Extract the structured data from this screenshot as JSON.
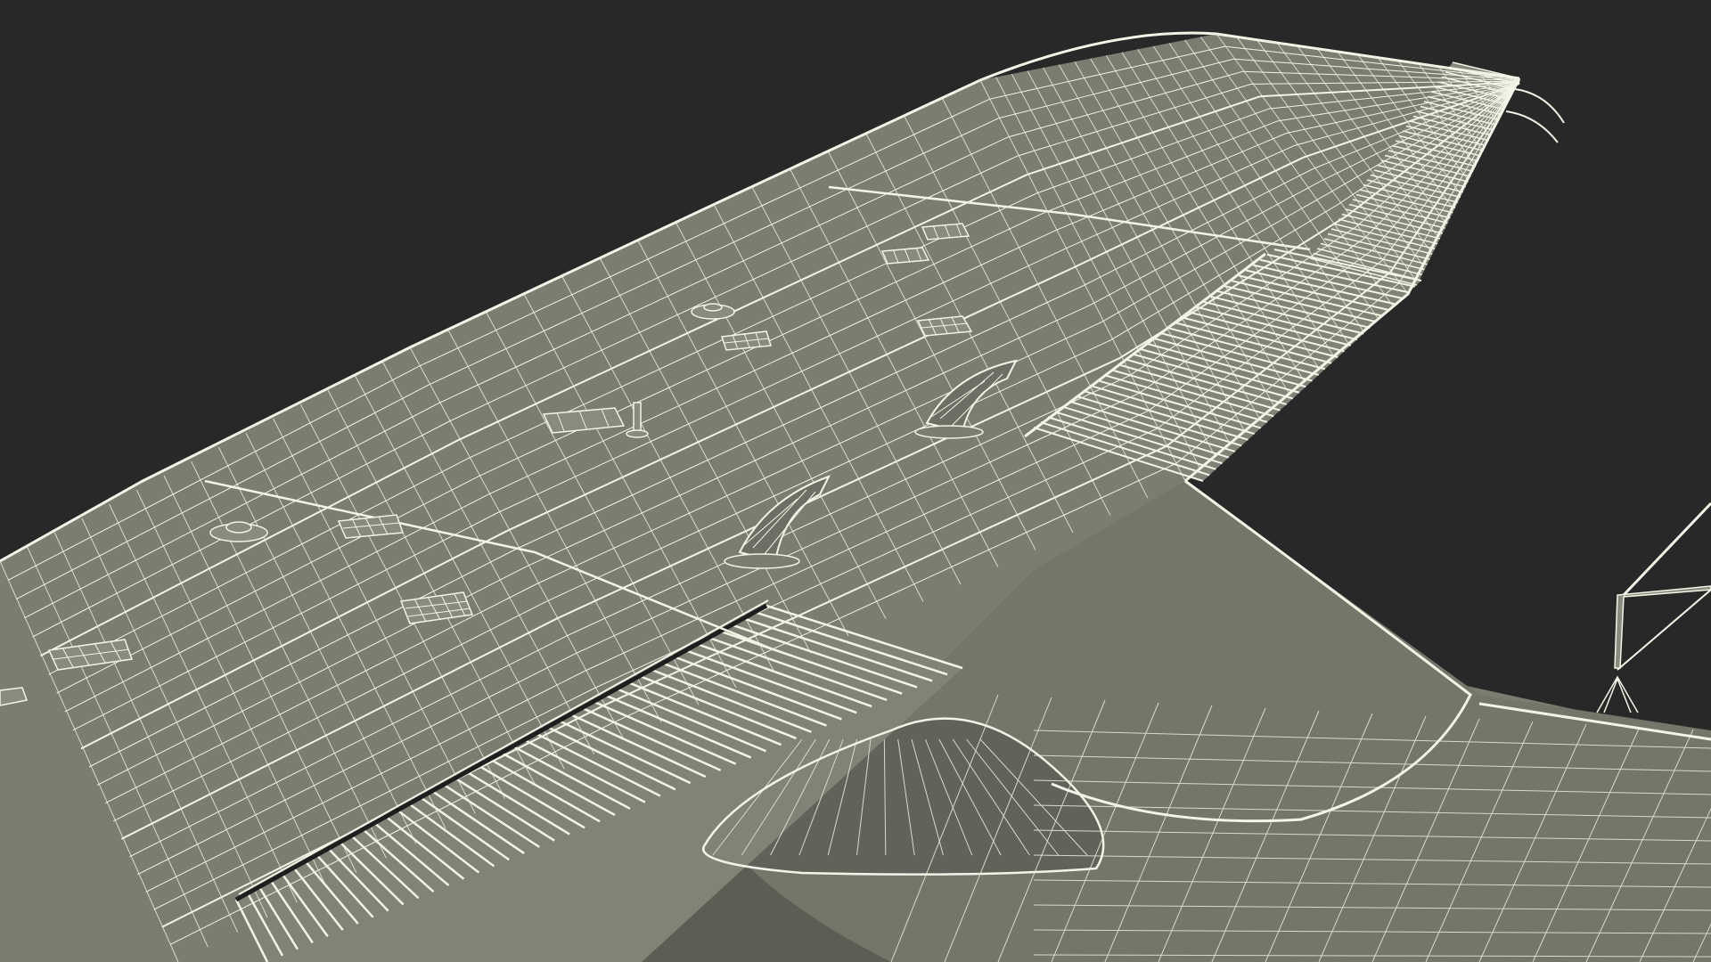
{
  "scene": {
    "subject": "wing-wireframe",
    "colors": {
      "background": "#282828",
      "surface": "#7c7c70",
      "surface_shadow": "#65655b",
      "surface_dark": "#5c5c53",
      "wire": "#f3f4e6",
      "wire_faint": "#d8dacb"
    }
  }
}
